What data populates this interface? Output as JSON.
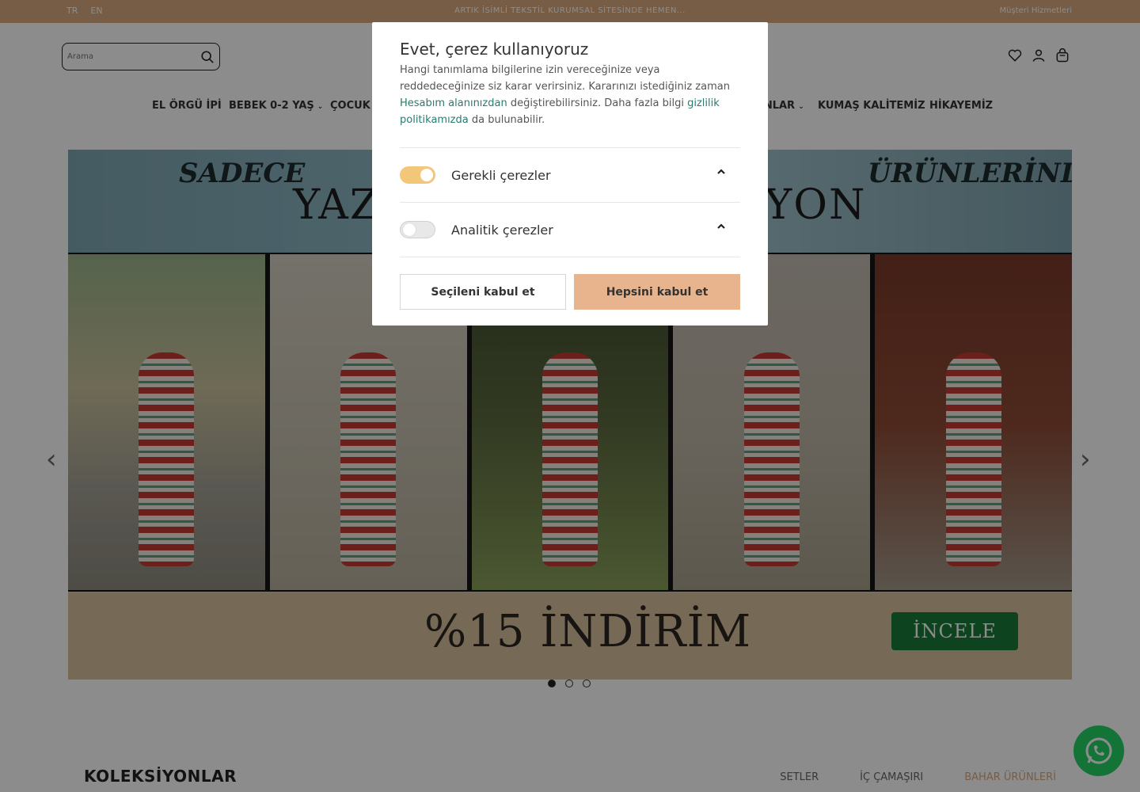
{
  "topbar": {
    "lang_tr": "TR",
    "lang_en": "EN",
    "message": "ARTIK İSİMLİ TEKSTİL KURUMSAL SİTESİNDE HEMEN...",
    "right_text": "Müşteri Hizmetleri"
  },
  "search": {
    "placeholder": "Arama"
  },
  "nav": {
    "items": [
      "EL ÖRGÜ İPİ",
      "BEBEK 0-2 YAŞ",
      "ÇOCUK",
      "...NLAR",
      "KUMAŞ KALİTEMİZ",
      "HİKAYEMİZ"
    ]
  },
  "hero": {
    "script_left": "SADECE",
    "script_right": "ÜRÜNLERİNDE",
    "big_left": "YAZ",
    "big_right": "YON",
    "discount": "%15 İNDİRİM",
    "cta": "İNCELE"
  },
  "slider": {
    "prev": "‹",
    "next": "›"
  },
  "collections": {
    "title": "KOLEKSİYONLAR",
    "tabs": [
      "SETLER",
      "İÇ ÇAMAŞIRI",
      "BAHAR ÜRÜNLERİ"
    ]
  },
  "cookie": {
    "title": "Evet, çerez kullanıyoruz",
    "text_1": "Hangi tanımlama bilgilerine izin vereceğinize veya reddedeceğinize siz karar verirsiniz. Kararınızı istediğiniz zaman ",
    "link_account": "Hesabım alanınızdan",
    "text_2": " değiştirebilirsiniz. Daha fazla bilgi ",
    "link_privacy": "gizlilik politikamızda",
    "text_3": " da bulunabilir.",
    "sections": [
      {
        "label": "Gerekli çerezler",
        "enabled": true
      },
      {
        "label": "Analitik çerezler",
        "enabled": false
      }
    ],
    "accept_selected": "Seçileni kabul et",
    "accept_all": "Hepsini kabul et"
  },
  "colors": {
    "accent": "#d9a97f",
    "toggle_on": "#f3c77a",
    "accept_all_bg": "#e8b48d",
    "link": "#2a7a6f",
    "whatsapp": "#25d366"
  }
}
